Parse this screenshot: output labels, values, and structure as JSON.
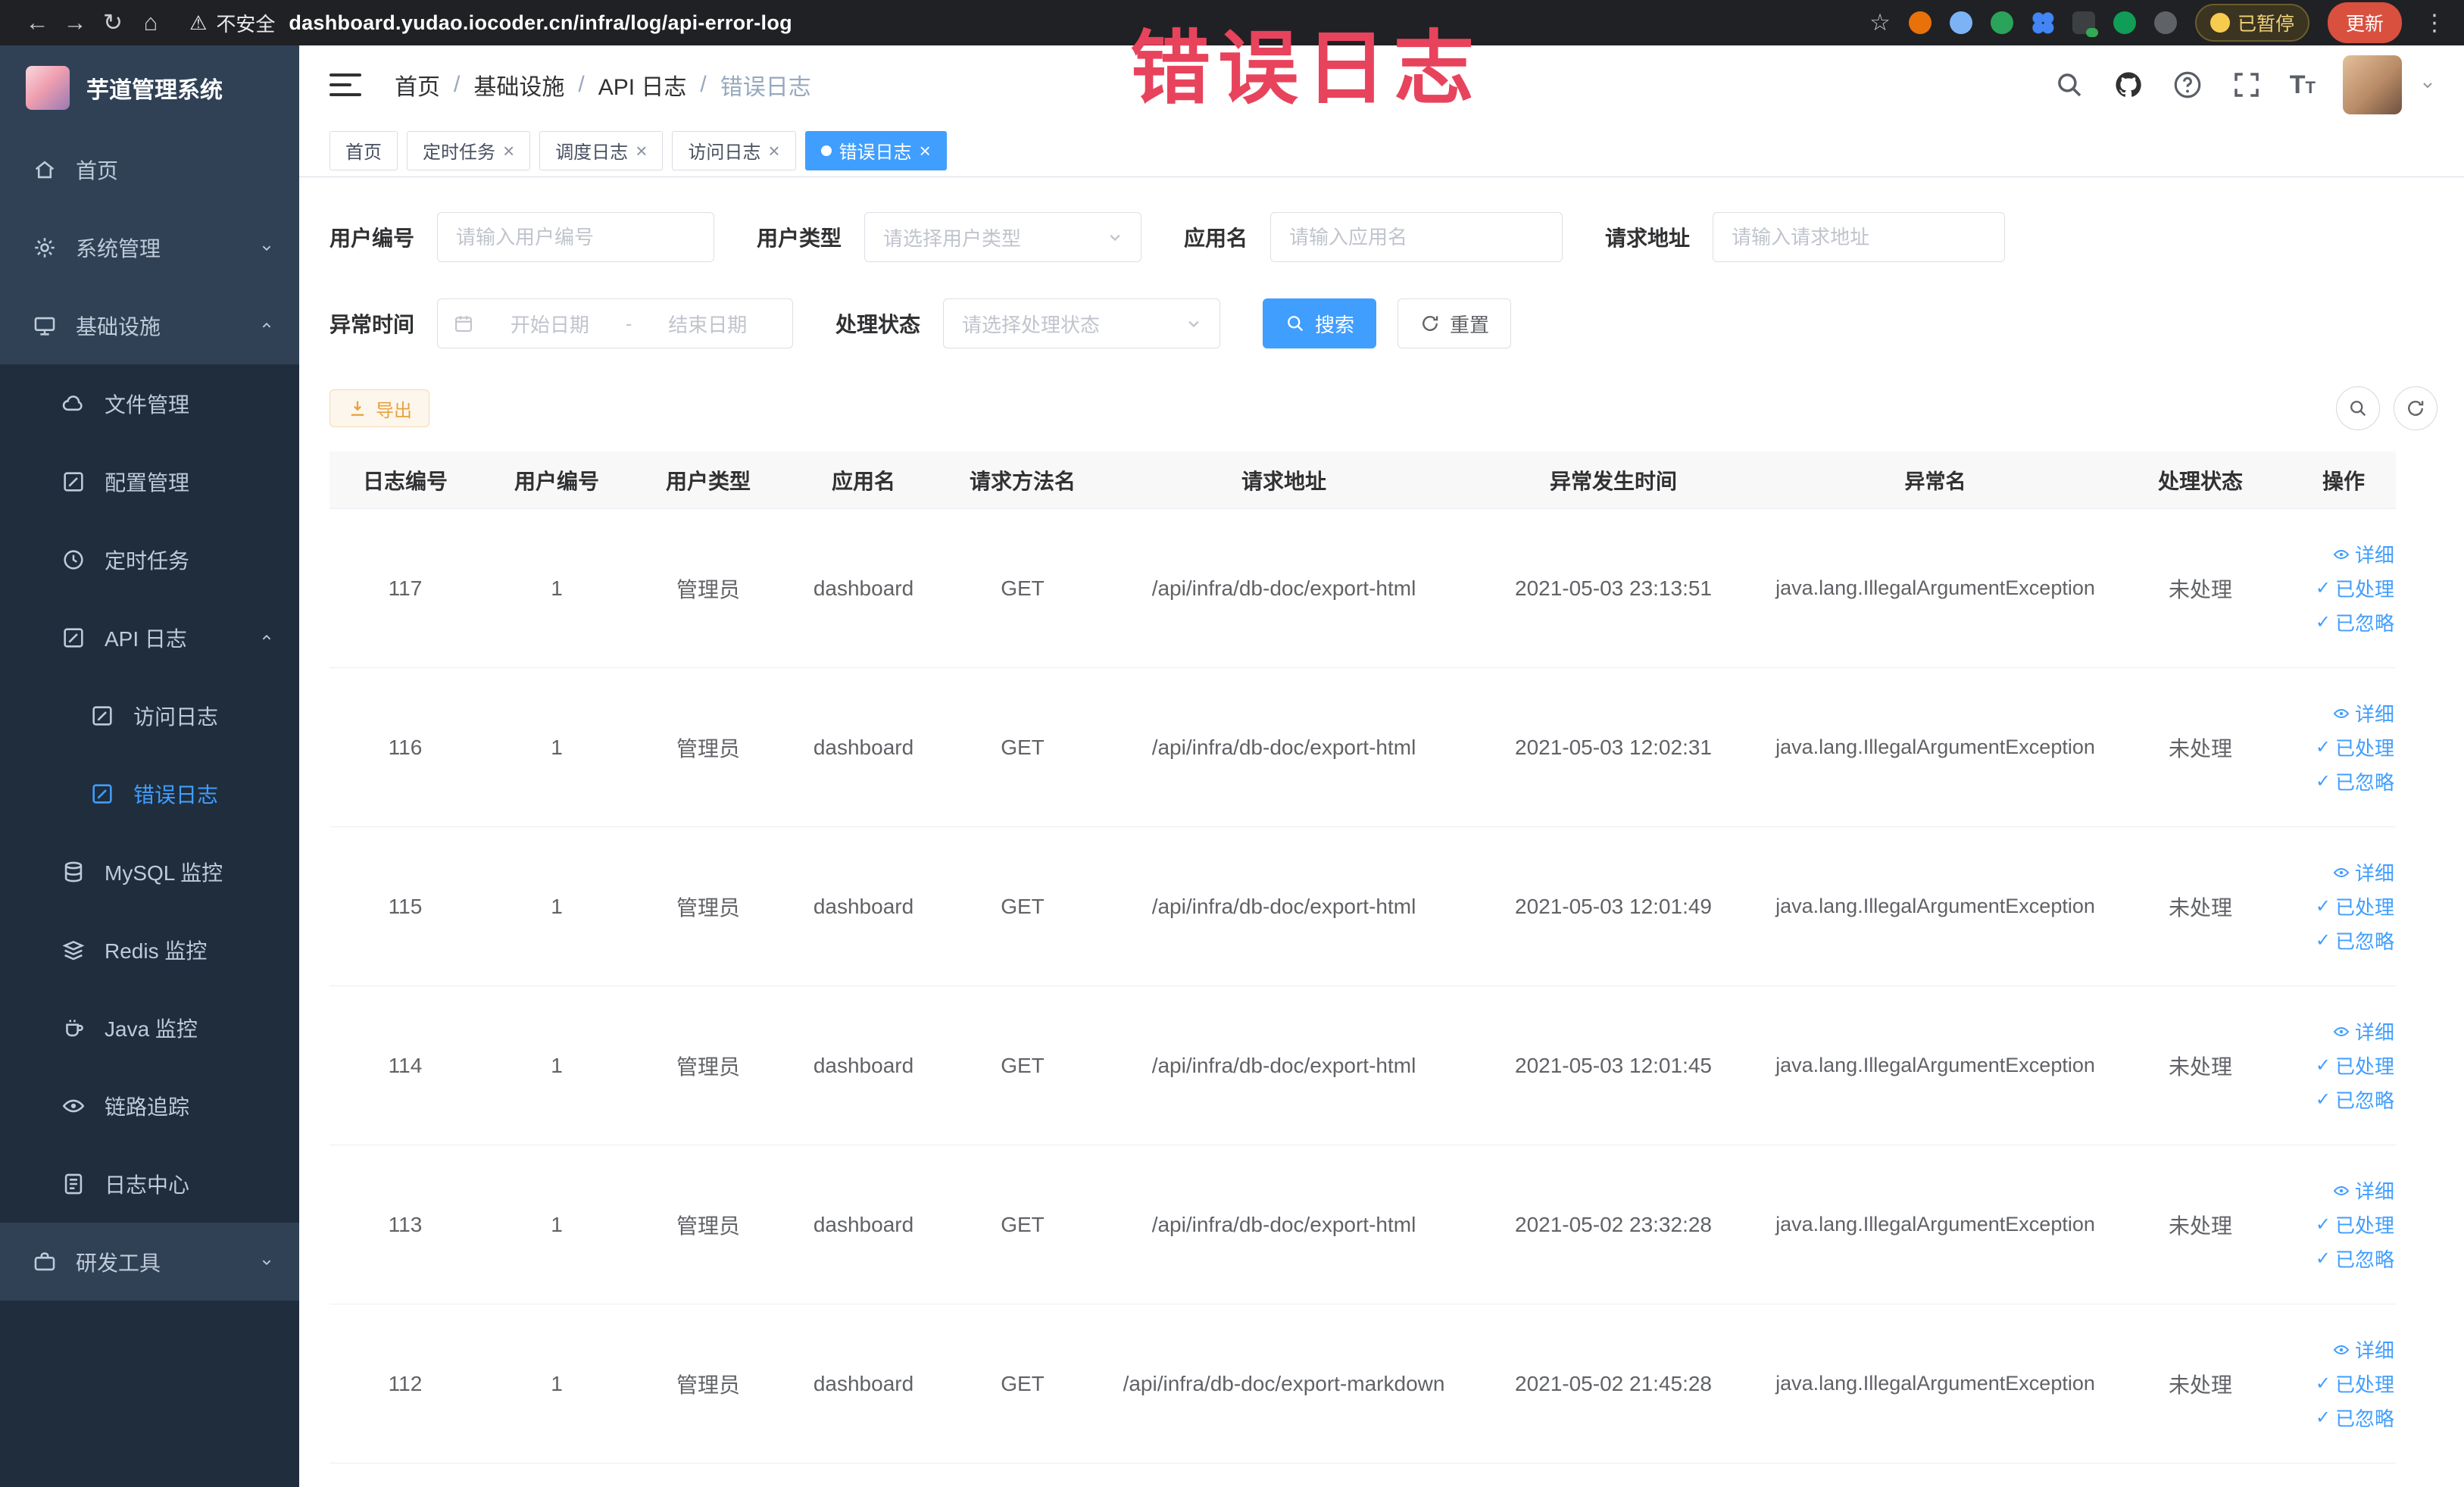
{
  "browser": {
    "security_label": "不安全",
    "url": "dashboard.yudao.iocoder.cn/infra/log/api-error-log",
    "paused_label": "已暂停",
    "update_label": "更新"
  },
  "icons": {
    "back": "←",
    "forward": "→",
    "reload": "↻",
    "home": "⌂",
    "warning": "⚠",
    "star": "☆",
    "kebab": "⋮",
    "close": "×",
    "check": "✓",
    "separator": "/",
    "text_big": "T",
    "text_small": "T",
    "range_separator": "-"
  },
  "annotation": {
    "text": "错误日志"
  },
  "sidebar": {
    "logo_title": "芋道管理系统",
    "items": [
      {
        "label": "首页"
      },
      {
        "label": "系统管理"
      },
      {
        "label": "基础设施"
      },
      {
        "label": "文件管理"
      },
      {
        "label": "配置管理"
      },
      {
        "label": "定时任务"
      },
      {
        "label": "API 日志"
      },
      {
        "label": "访问日志"
      },
      {
        "label": "错误日志"
      },
      {
        "label": "MySQL 监控"
      },
      {
        "label": "Redis 监控"
      },
      {
        "label": "Java 监控"
      },
      {
        "label": "链路追踪"
      },
      {
        "label": "日志中心"
      },
      {
        "label": "研发工具"
      }
    ]
  },
  "header": {
    "breadcrumb": [
      "首页",
      "基础设施",
      "API 日志",
      "错误日志"
    ]
  },
  "tabs": [
    {
      "label": "首页"
    },
    {
      "label": "定时任务"
    },
    {
      "label": "调度日志"
    },
    {
      "label": "访问日志"
    },
    {
      "label": "错误日志"
    }
  ],
  "filters": {
    "user_id_label": "用户编号",
    "user_id_placeholder": "请输入用户编号",
    "user_type_label": "用户类型",
    "user_type_placeholder": "请选择用户类型",
    "app_name_label": "应用名",
    "app_name_placeholder": "请输入应用名",
    "request_url_label": "请求地址",
    "request_url_placeholder": "请输入请求地址",
    "time_label": "异常时间",
    "time_start_placeholder": "开始日期",
    "time_end_placeholder": "结束日期",
    "status_label": "处理状态",
    "status_placeholder": "请选择处理状态",
    "search_label": "搜索",
    "reset_label": "重置"
  },
  "toolbar": {
    "export_label": "导出"
  },
  "table": {
    "columns": [
      "日志编号",
      "用户编号",
      "用户类型",
      "应用名",
      "请求方法名",
      "请求地址",
      "异常发生时间",
      "异常名",
      "处理状态",
      "操作"
    ],
    "actions": {
      "detail": "详细",
      "processed": "已处理",
      "ignored": "已忽略"
    },
    "rows": [
      {
        "log_id": "117",
        "user_id": "1",
        "user_type": "管理员",
        "app_name": "dashboard",
        "method": "GET",
        "url": "/api/infra/db-doc/export-html",
        "time": "2021-05-03 23:13:51",
        "exception": "java.lang.IllegalArgumentException",
        "status": "未处理"
      },
      {
        "log_id": "116",
        "user_id": "1",
        "user_type": "管理员",
        "app_name": "dashboard",
        "method": "GET",
        "url": "/api/infra/db-doc/export-html",
        "time": "2021-05-03 12:02:31",
        "exception": "java.lang.IllegalArgumentException",
        "status": "未处理"
      },
      {
        "log_id": "115",
        "user_id": "1",
        "user_type": "管理员",
        "app_name": "dashboard",
        "method": "GET",
        "url": "/api/infra/db-doc/export-html",
        "time": "2021-05-03 12:01:49",
        "exception": "java.lang.IllegalArgumentException",
        "status": "未处理"
      },
      {
        "log_id": "114",
        "user_id": "1",
        "user_type": "管理员",
        "app_name": "dashboard",
        "method": "GET",
        "url": "/api/infra/db-doc/export-html",
        "time": "2021-05-03 12:01:45",
        "exception": "java.lang.IllegalArgumentException",
        "status": "未处理"
      },
      {
        "log_id": "113",
        "user_id": "1",
        "user_type": "管理员",
        "app_name": "dashboard",
        "method": "GET",
        "url": "/api/infra/db-doc/export-html",
        "time": "2021-05-02 23:32:28",
        "exception": "java.lang.IllegalArgumentException",
        "status": "未处理"
      },
      {
        "log_id": "112",
        "user_id": "1",
        "user_type": "管理员",
        "app_name": "dashboard",
        "method": "GET",
        "url": "/api/infra/db-doc/export-markdown",
        "time": "2021-05-02 21:45:28",
        "exception": "java.lang.IllegalArgumentException",
        "status": "未处理"
      }
    ]
  },
  "colors": {
    "accent": "#409eff",
    "sidebar": "#304156",
    "submenu": "#1f2d3d",
    "warning": "#e6a23c",
    "annotation": "#e8435c",
    "chrome": "#202124"
  }
}
